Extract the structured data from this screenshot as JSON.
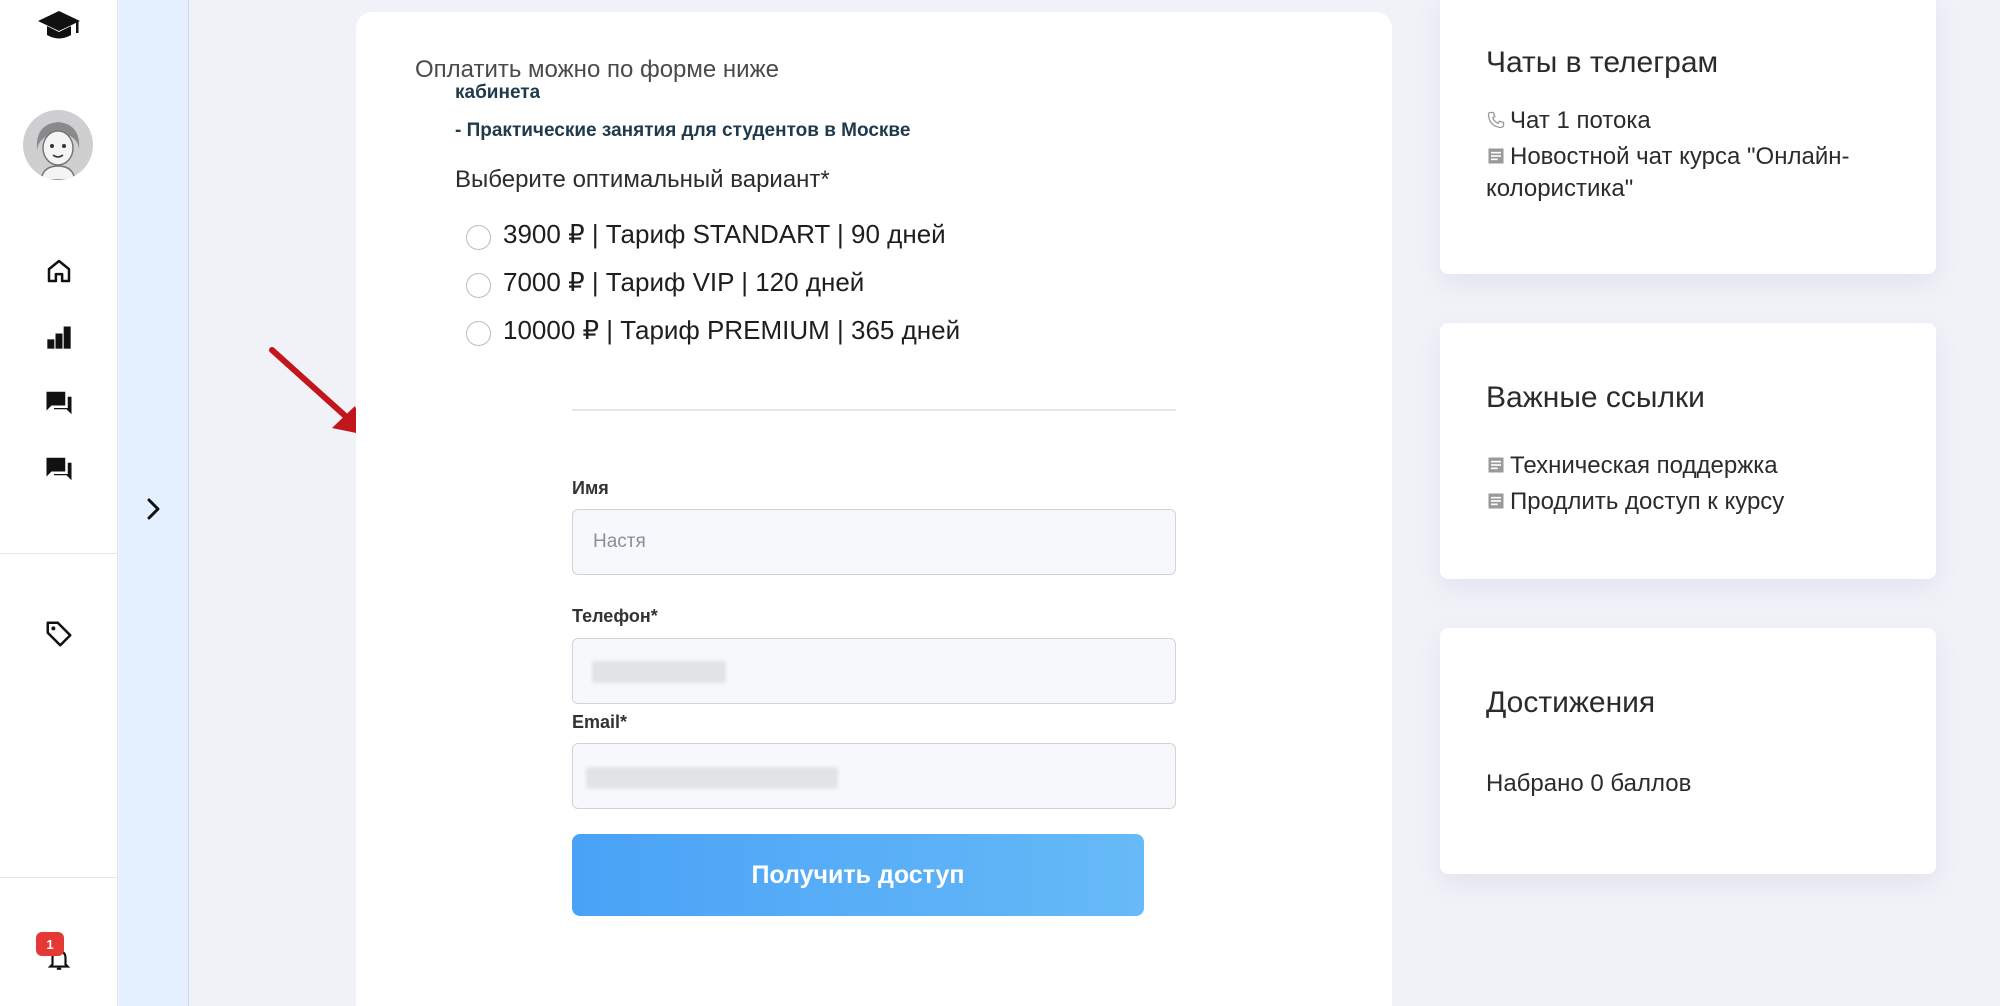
{
  "sidebar": {
    "icons": [
      "graduation-cap-icon",
      "home-icon",
      "bar-chart-icon",
      "chat-icon",
      "chat-icon",
      "tag-icon",
      "bell-icon"
    ],
    "notification_count": "1"
  },
  "main": {
    "intro": "Оплатить можно по форме ниже",
    "cut_text": "кабинета",
    "practice": "- Практические занятия для студентов в Москве",
    "choose_label": "Выберите оптимальный вариант*",
    "options": [
      {
        "label": "3900 ₽ | Тариф STANDART | 90 дней"
      },
      {
        "label": "7000 ₽ | Тариф VIP | 120 дней"
      },
      {
        "label": "10000 ₽ | Тариф PREMIUM | 365 дней"
      }
    ],
    "form": {
      "name_label": "Имя",
      "name_placeholder": "Настя",
      "phone_label": "Телефон*",
      "email_label": "Email*",
      "submit_label": "Получить доступ"
    }
  },
  "telegram": {
    "title": "Чаты в телеграм",
    "links": [
      {
        "label": "Чат 1 потока",
        "icon": "phone-icon"
      },
      {
        "label": "Новостной чат курса \"Онлайн-колористика\"",
        "icon": "news-icon"
      }
    ]
  },
  "links": {
    "title": "Важные ссылки",
    "items": [
      {
        "label": "Техническая поддержка",
        "icon": "news-icon"
      },
      {
        "label": "Продлить доступ к курсу",
        "icon": "news-icon"
      }
    ]
  },
  "achievements": {
    "title": "Достижения",
    "points_text": "Набрано 0 баллов"
  },
  "colors": {
    "accent_blue": "#4aa2f7",
    "badge_red": "#e53935",
    "arrow_red": "#c0161c",
    "strip_blue": "#e4efff"
  }
}
